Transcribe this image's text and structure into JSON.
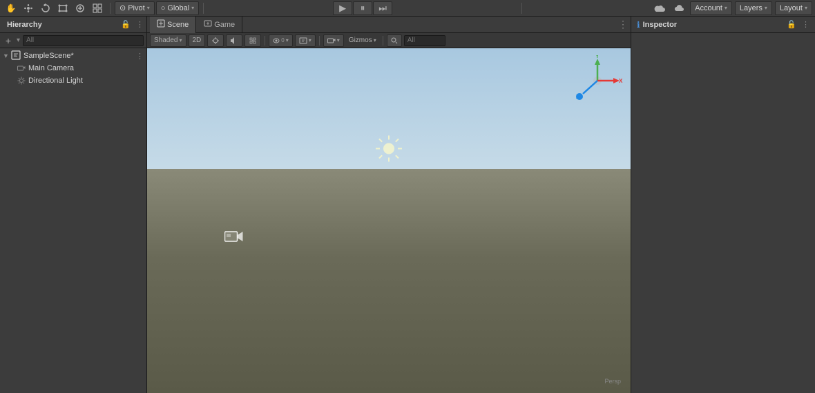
{
  "topToolbar": {
    "tools": [
      {
        "name": "hand",
        "icon": "✋",
        "label": "Hand Tool",
        "active": false
      },
      {
        "name": "move",
        "icon": "⊕",
        "label": "Move Tool",
        "active": false
      },
      {
        "name": "rotate",
        "icon": "↺",
        "label": "Rotate Tool",
        "active": false
      },
      {
        "name": "rect",
        "icon": "▭",
        "label": "Rect Tool",
        "active": false
      },
      {
        "name": "transform",
        "icon": "✦",
        "label": "Transform Tool",
        "active": false
      },
      {
        "name": "custom",
        "icon": "⊞",
        "label": "Custom Tool",
        "active": false
      }
    ],
    "pivot_label": "Pivot",
    "global_label": "Global",
    "account_label": "Account",
    "layers_label": "Layers",
    "layout_label": "Layout"
  },
  "playControls": {
    "play_label": "▶",
    "pause_label": "⏸",
    "step_label": "⏭"
  },
  "hierarchy": {
    "title": "Hierarchy",
    "search_placeholder": "All",
    "scene_name": "SampleScene*",
    "items": [
      {
        "name": "Main Camera",
        "icon": "📷"
      },
      {
        "name": "Directional Light",
        "icon": "☀"
      }
    ]
  },
  "sceneView": {
    "tabs": [
      {
        "label": "Scene",
        "icon": "◉",
        "active": true
      },
      {
        "label": "Game",
        "icon": "🎮",
        "active": false
      }
    ],
    "toolbar": {
      "shaded_label": "Shaded",
      "twod_label": "2D",
      "gizmos_label": "Gizmos",
      "search_placeholder": "All"
    }
  },
  "inspector": {
    "title": "Inspector"
  }
}
